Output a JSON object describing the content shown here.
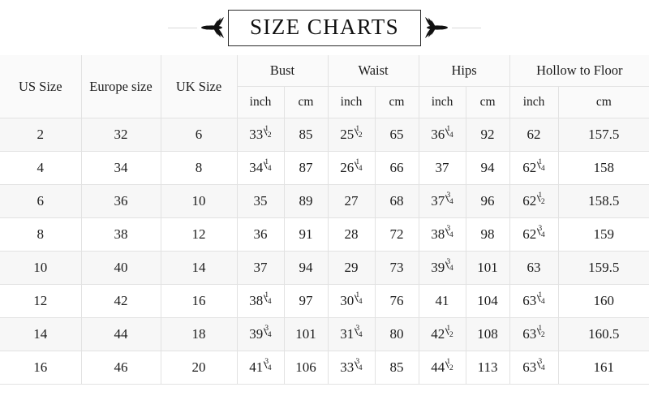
{
  "title": {
    "text": "SIZE CHARTS",
    "ornament_left": "fleuron-ornament-left",
    "ornament_right": "fleuron-ornament-right"
  },
  "chart_data": {
    "type": "table",
    "title": "SIZE CHARTS",
    "group_headers": [
      {
        "label": "US Size",
        "colspan": 1,
        "rowspan": 2
      },
      {
        "label": "Europe size",
        "colspan": 1,
        "rowspan": 2
      },
      {
        "label": "UK Size",
        "colspan": 1,
        "rowspan": 2
      },
      {
        "label": "Bust",
        "colspan": 2,
        "rowspan": 1
      },
      {
        "label": "Waist",
        "colspan": 2,
        "rowspan": 1
      },
      {
        "label": "Hips",
        "colspan": 2,
        "rowspan": 1
      },
      {
        "label": "Hollow to Floor",
        "colspan": 2,
        "rowspan": 1
      }
    ],
    "unit_headers": [
      "inch",
      "cm",
      "inch",
      "cm",
      "inch",
      "cm",
      "inch",
      "cm"
    ],
    "columns": [
      "US Size",
      "Europe size",
      "UK Size",
      "Bust inch",
      "Bust cm",
      "Waist inch",
      "Waist cm",
      "Hips inch",
      "Hips cm",
      "Hollow to Floor inch",
      "Hollow to Floor cm"
    ],
    "rows": [
      {
        "us": "2",
        "europe": "32",
        "uk": "6",
        "bust_inch": {
          "whole": "33",
          "num": "1",
          "den": "2"
        },
        "bust_cm": "85",
        "waist_inch": {
          "whole": "25",
          "num": "1",
          "den": "2"
        },
        "waist_cm": "65",
        "hips_inch": {
          "whole": "36",
          "num": "1",
          "den": "4"
        },
        "hips_cm": "92",
        "hollow_inch": {
          "whole": "62",
          "num": "",
          "den": ""
        },
        "hollow_cm": "157.5"
      },
      {
        "us": "4",
        "europe": "34",
        "uk": "8",
        "bust_inch": {
          "whole": "34",
          "num": "1",
          "den": "4"
        },
        "bust_cm": "87",
        "waist_inch": {
          "whole": "26",
          "num": "1",
          "den": "4"
        },
        "waist_cm": "66",
        "hips_inch": {
          "whole": "37",
          "num": "",
          "den": ""
        },
        "hips_cm": "94",
        "hollow_inch": {
          "whole": "62",
          "num": "1",
          "den": "4"
        },
        "hollow_cm": "158"
      },
      {
        "us": "6",
        "europe": "36",
        "uk": "10",
        "bust_inch": {
          "whole": "35",
          "num": "",
          "den": ""
        },
        "bust_cm": "89",
        "waist_inch": {
          "whole": "27",
          "num": "",
          "den": ""
        },
        "waist_cm": "68",
        "hips_inch": {
          "whole": "37",
          "num": "3",
          "den": "4"
        },
        "hips_cm": "96",
        "hollow_inch": {
          "whole": "62",
          "num": "1",
          "den": "2"
        },
        "hollow_cm": "158.5"
      },
      {
        "us": "8",
        "europe": "38",
        "uk": "12",
        "bust_inch": {
          "whole": "36",
          "num": "",
          "den": ""
        },
        "bust_cm": "91",
        "waist_inch": {
          "whole": "28",
          "num": "",
          "den": ""
        },
        "waist_cm": "72",
        "hips_inch": {
          "whole": "38",
          "num": "3",
          "den": "4"
        },
        "hips_cm": "98",
        "hollow_inch": {
          "whole": "62",
          "num": "3",
          "den": "4"
        },
        "hollow_cm": "159"
      },
      {
        "us": "10",
        "europe": "40",
        "uk": "14",
        "bust_inch": {
          "whole": "37",
          "num": "",
          "den": ""
        },
        "bust_cm": "94",
        "waist_inch": {
          "whole": "29",
          "num": "",
          "den": ""
        },
        "waist_cm": "73",
        "hips_inch": {
          "whole": "39",
          "num": "3",
          "den": "4"
        },
        "hips_cm": "101",
        "hollow_inch": {
          "whole": "63",
          "num": "",
          "den": ""
        },
        "hollow_cm": "159.5"
      },
      {
        "us": "12",
        "europe": "42",
        "uk": "16",
        "bust_inch": {
          "whole": "38",
          "num": "1",
          "den": "4"
        },
        "bust_cm": "97",
        "waist_inch": {
          "whole": "30",
          "num": "1",
          "den": "4"
        },
        "waist_cm": "76",
        "hips_inch": {
          "whole": "41",
          "num": "",
          "den": ""
        },
        "hips_cm": "104",
        "hollow_inch": {
          "whole": "63",
          "num": "1",
          "den": "4"
        },
        "hollow_cm": "160"
      },
      {
        "us": "14",
        "europe": "44",
        "uk": "18",
        "bust_inch": {
          "whole": "39",
          "num": "3",
          "den": "4"
        },
        "bust_cm": "101",
        "waist_inch": {
          "whole": "31",
          "num": "3",
          "den": "4"
        },
        "waist_cm": "80",
        "hips_inch": {
          "whole": "42",
          "num": "1",
          "den": "2"
        },
        "hips_cm": "108",
        "hollow_inch": {
          "whole": "63",
          "num": "1",
          "den": "2"
        },
        "hollow_cm": "160.5"
      },
      {
        "us": "16",
        "europe": "46",
        "uk": "20",
        "bust_inch": {
          "whole": "41",
          "num": "3",
          "den": "4"
        },
        "bust_cm": "106",
        "waist_inch": {
          "whole": "33",
          "num": "3",
          "den": "4"
        },
        "waist_cm": "85",
        "hips_inch": {
          "whole": "44",
          "num": "1",
          "den": "2"
        },
        "hips_cm": "113",
        "hollow_inch": {
          "whole": "63",
          "num": "3",
          "den": "4"
        },
        "hollow_cm": "161"
      }
    ]
  },
  "colors": {
    "page_background": "#ffffff",
    "header_background": "#fafafa",
    "row_odd_background": "#f7f7f7",
    "row_even_background": "#ffffff",
    "grid_line": "#e2e2e2",
    "text": "#1c1c1c",
    "title_border": "#2b2b2b",
    "rule": "#d9d9d9"
  }
}
